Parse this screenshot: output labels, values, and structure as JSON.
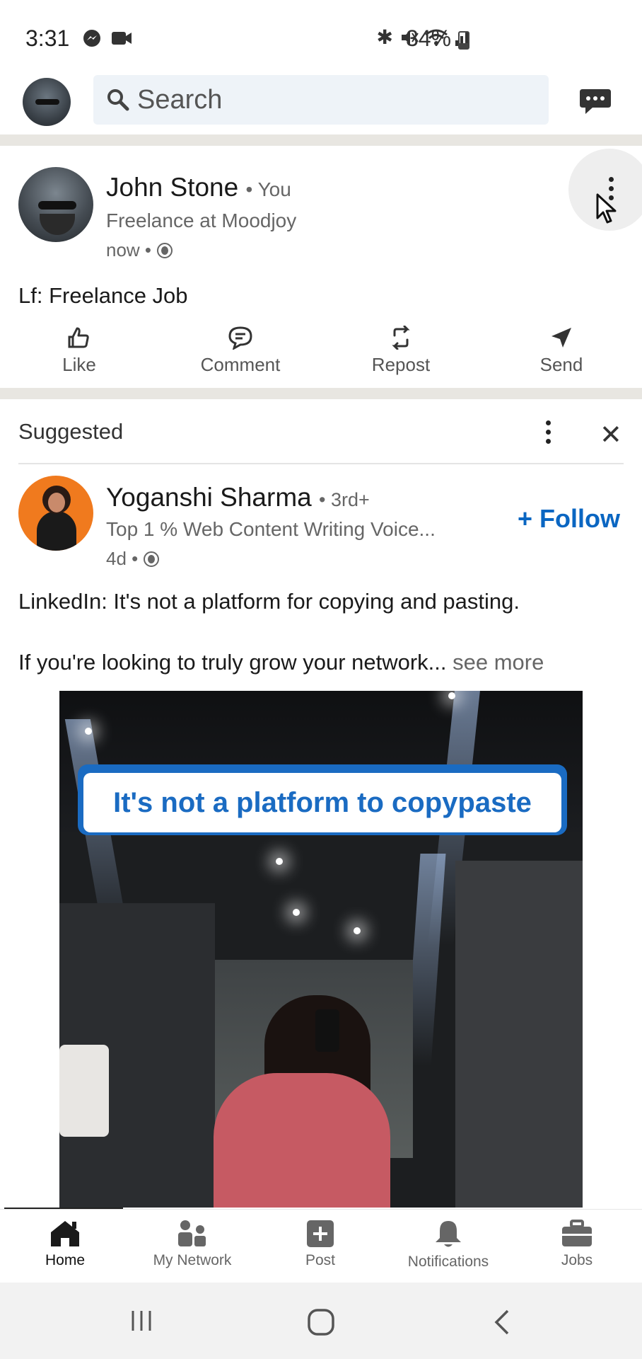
{
  "status_bar": {
    "time": "3:31",
    "battery": "34%",
    "battery_level": 0.34
  },
  "top_bar": {
    "search_placeholder": "Search",
    "icons": [
      "profile-avatar",
      "search-icon",
      "messaging-icon"
    ]
  },
  "post1": {
    "author_name": "John Stone",
    "relation": "• You",
    "headline": "Freelance at Moodjoy",
    "time": "now •",
    "text": "Lf: Freelance Job",
    "actions": [
      {
        "label": "Like",
        "icon": "like-icon"
      },
      {
        "label": "Comment",
        "icon": "comment-icon"
      },
      {
        "label": "Repost",
        "icon": "repost-icon"
      },
      {
        "label": "Send",
        "icon": "send-icon"
      }
    ]
  },
  "suggested": {
    "label": "Suggested"
  },
  "post2": {
    "author_name": "Yoganshi Sharma",
    "relation": "• 3rd+",
    "headline": "Top 1 % Web Content Writing Voice...",
    "time": "4d •",
    "follow_label": "+ Follow",
    "text_line1": "LinkedIn: It's not a platform for copying and pasting.",
    "text_line2": "If you're looking to truly grow your network...",
    "see_more": "see more",
    "image_banner": "It's not a platform to copypaste"
  },
  "bottom_nav": {
    "items": [
      {
        "label": "Home",
        "icon": "home-icon",
        "active": true
      },
      {
        "label": "My Network",
        "icon": "network-icon",
        "active": false
      },
      {
        "label": "Post",
        "icon": "post-icon",
        "active": false
      },
      {
        "label": "Notifications",
        "icon": "bell-icon",
        "active": false
      },
      {
        "label": "Jobs",
        "icon": "briefcase-icon",
        "active": false
      }
    ]
  },
  "colors": {
    "brand_blue": "#0a66c2",
    "banner_blue": "#1a6bc2",
    "divider": "#e8e6e1"
  }
}
